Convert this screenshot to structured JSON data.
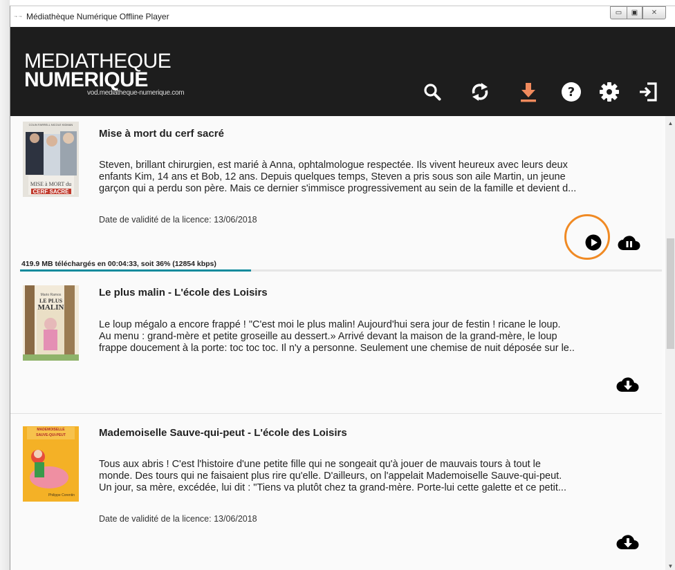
{
  "window": {
    "title": "Médiathèque Numérique Offline Player",
    "app_icon_text": "→→",
    "controls": {
      "minimize": "▭",
      "maximize": "▣",
      "close": "✕"
    }
  },
  "header": {
    "logo": {
      "line1": "MEDIATHEQUE",
      "line2": "NUMERIQUE",
      "url": "vod.mediatheque-numerique.com"
    },
    "icons": [
      "search-icon",
      "sync-icon",
      "download-icon",
      "help-icon",
      "settings-icon",
      "logout-icon"
    ],
    "accent_download": "#f08a5d"
  },
  "items": [
    {
      "title": "Mise à mort du cerf sacré",
      "description": [
        "Steven, brillant chirurgien, est marié à Anna, ophtalmologue respectée. Ils vivent heureux avec leurs deux",
        "enfants Kim, 14 ans et Bob, 12 ans. Depuis quelques temps, Steven a pris sous son aile Martin, un jeune",
        "garçon qui a perdu son père. Mais ce dernier s'immisce progressivement au sein de la famille et devient d..."
      ],
      "license": "Date de validité de la licence: 13/06/2018",
      "poster_text": {
        "top": "COLIN FARRELL   NICOLE KIDMAN",
        "line1": "MISE à MORT du",
        "line2": "CERF SACRÉ"
      },
      "actions": [
        "play-icon",
        "pause-download-icon"
      ],
      "progress": {
        "text": "419.9 MB téléchargés en 00:04:33, soit 36% (12854 kbps)",
        "percent": 36
      }
    },
    {
      "title": "Le plus malin - L'école des Loisirs",
      "description": [
        "Le loup mégalo a encore frappé !   \"C'est moi le plus malin! Aujourd'hui sera jour de festin ! ricane le loup.",
        "Au menu : grand-mère et petite groseille au dessert.» Arrivé devant la maison de la grand-mère, le loup",
        "frappe doucement à la porte: toc toc toc. Il n'y a personne. Seulement une chemise de nuit déposée sur le.."
      ],
      "license": "",
      "poster_text": {
        "top": "Mario Ramos",
        "line1": "LE PLUS",
        "line2": "MALIN"
      },
      "actions": [
        "cloud-download-icon"
      ]
    },
    {
      "title": "Mademoiselle Sauve-qui-peut - L'école des Loisirs",
      "description": [
        "Tous aux abris !   C'est l'histoire d'une petite fille qui ne songeait qu'à jouer de mauvais tours à tout le",
        "monde. Des tours qui ne faisaient plus rire qu'elle. D'ailleurs, on l'appelait Mademoiselle Sauve-qui-peut.",
        "Un jour, sa mère, excédée, lui dit : \"Tiens va plutôt chez ta grand-mère. Porte-lui cette galette et ce petit..."
      ],
      "license": "Date de validité de la licence: 13/06/2018",
      "poster_text": {
        "top": "MADEMOISELLE",
        "line1": "SAUVE-QUI-PEUT",
        "line2": "Philippe Corentin"
      },
      "actions": [
        "cloud-download-icon"
      ]
    }
  ],
  "scrollbar": {
    "up": "▲",
    "down": "▼"
  }
}
